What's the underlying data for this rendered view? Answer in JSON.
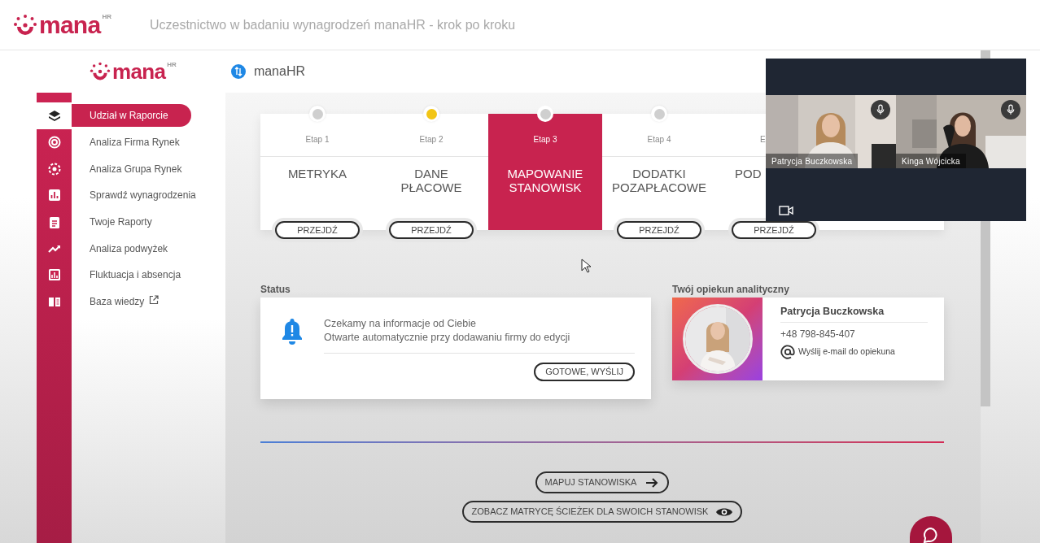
{
  "top_bar": {
    "logo": {
      "name": "mana",
      "suffix": "HR"
    },
    "title": "Uczestnictwo w badaniu wynagrodzeń manaHR - krok po kroku"
  },
  "app_header": {
    "logo": {
      "name": "mana",
      "suffix": "HR"
    },
    "workspace": "manaHR"
  },
  "sidebar": {
    "items": [
      {
        "label": "Udział w Raporcie",
        "selected": true,
        "external": false
      },
      {
        "label": "Analiza Firma Rynek",
        "selected": false,
        "external": false
      },
      {
        "label": "Analiza Grupa Rynek",
        "selected": false,
        "external": false
      },
      {
        "label": "Sprawdź wynagrodzenia",
        "selected": false,
        "external": false
      },
      {
        "label": "Twoje Raporty",
        "selected": false,
        "external": false
      },
      {
        "label": "Analiza podwyżek",
        "selected": false,
        "external": false
      },
      {
        "label": "Fluktuacja i absencja",
        "selected": false,
        "external": false
      },
      {
        "label": "Baza wiedzy",
        "selected": false,
        "external": true
      }
    ]
  },
  "steps": [
    {
      "label": "Etap 1",
      "title": "METRYKA",
      "selected": false,
      "color": "#cfcfcf",
      "button": "PRZEJDŹ"
    },
    {
      "label": "Etap 2",
      "title": "DANE\nPŁACOWE",
      "selected": false,
      "color": "#f2c515",
      "button": "PRZEJDŹ"
    },
    {
      "label": "Etap 3",
      "title": "MAPOWANIE\nSTANOWISK",
      "selected": true,
      "color": "#cfcfcf"
    },
    {
      "label": "Etap 4",
      "title": "DODATKI\nPOZAPŁACOWE",
      "selected": false,
      "color": "#cfcfcf",
      "button": "PRZEJDŹ"
    },
    {
      "label": "E",
      "title": "POD",
      "selected": false,
      "button": "PRZEJDŹ"
    }
  ],
  "status": {
    "heading": "Status",
    "lines": [
      "Czekamy na informacje od Ciebie",
      "Otwarte automatycznie przy dodawaniu firmy do edycji"
    ],
    "button": "GOTOWE, WYŚLIJ"
  },
  "advisor": {
    "heading": "Twój opiekun analityczny",
    "name": "Patrycja Buczkowska",
    "phone": "+48 798-845-407",
    "email_link": "Wyślij e-mail do opiekuna"
  },
  "actions": [
    {
      "label": "MAPUJ STANOWISKA",
      "kind": "arrow"
    },
    {
      "label": "ZOBACZ MATRYCĘ ŚCIEŻEK DLA SWOICH STANOWISK",
      "kind": "eye"
    }
  ],
  "video_call": {
    "participants": [
      {
        "name": "Patrycja Buczkowska"
      },
      {
        "name": "Kinga Wójcicka"
      }
    ]
  }
}
